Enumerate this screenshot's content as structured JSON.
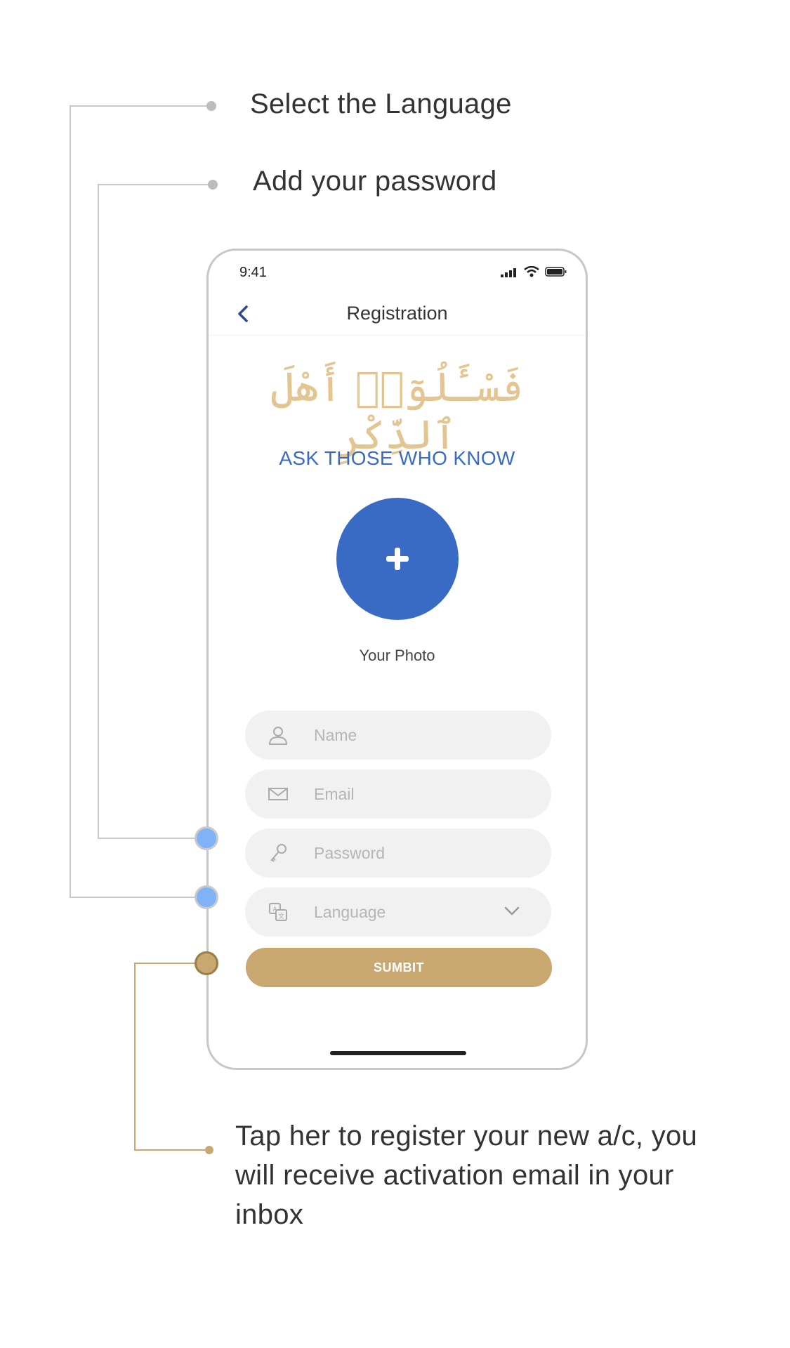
{
  "annotations": {
    "language": "Select the Language",
    "password": "Add your password",
    "submit": "Tap her to register your new a/c, you will receive activation email in your inbox"
  },
  "phone": {
    "status_time": "9:41",
    "nav": {
      "title": "Registration"
    },
    "arabic_title": "فَسْـَٔلُوٓا۟ أَهْلَ ٱلذِّكْرِ",
    "tagline": "ASK THOSE WHO KNOW",
    "photo_label": "Your Photo",
    "fields": {
      "name_placeholder": "Name",
      "email_placeholder": "Email",
      "password_placeholder": "Password",
      "language_placeholder": "Language"
    },
    "submit_label": "SUMBIT"
  },
  "colors": {
    "accent_blue": "#3a6bc4",
    "gold": "#c8a771",
    "arabic_gold": "#e2c591",
    "annotation_dot_blue": "#7fb2f7",
    "connector_gray": "#c9c9c9"
  },
  "icons": {
    "back": "chevron-left-icon",
    "add_photo": "plus-icon",
    "name": "user-icon",
    "email": "mail-icon",
    "password": "key-icon",
    "language": "translate-icon",
    "dropdown": "chevron-down-icon"
  }
}
